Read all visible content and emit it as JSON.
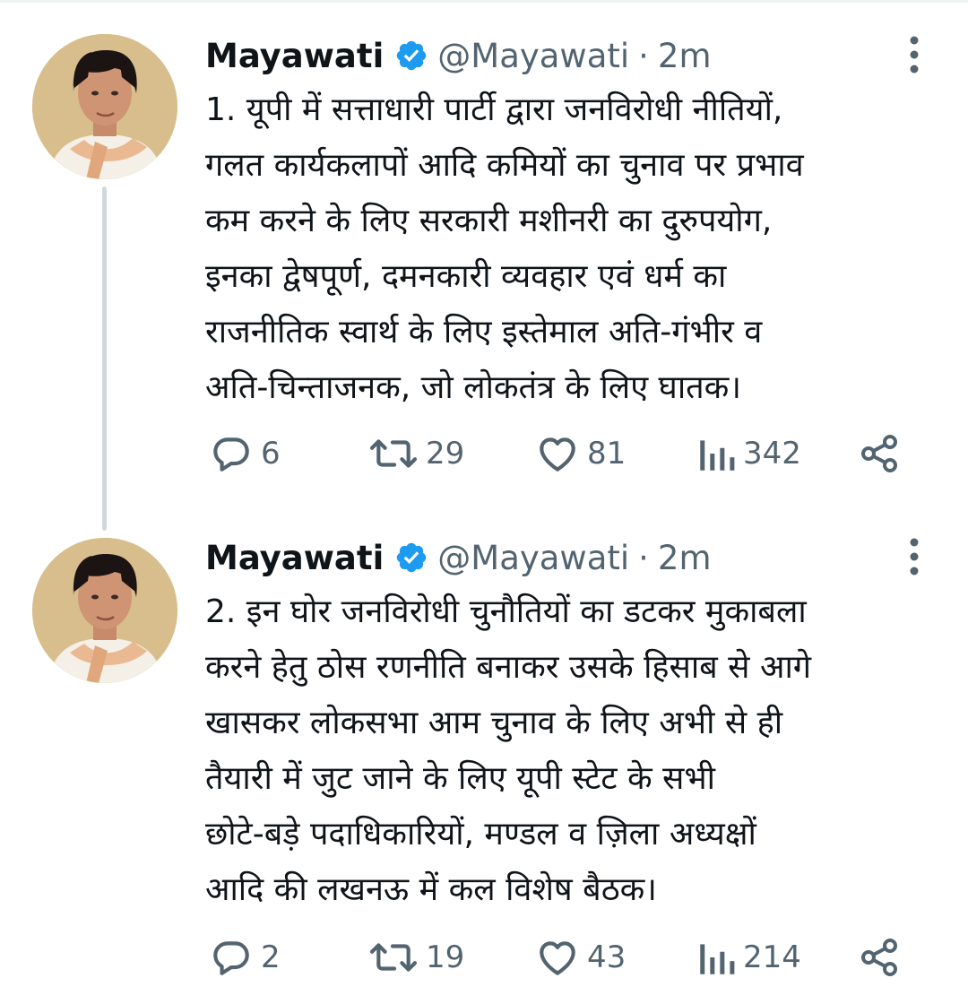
{
  "thread": {
    "tweets": [
      {
        "author": {
          "name": "Mayawati",
          "handle": "@Mayawati",
          "separator": "·",
          "time": "2m"
        },
        "text_lines": [
          "1. यूपी में सत्ताधारी पार्टी द्वारा जनविरोधी नीतियों,",
          "गलत कार्यकलापों आदि कमियों का चुनाव पर प्रभाव",
          "कम करने के लिए सरकारी मशीनरी का दुरुपयोग,",
          "इनका द्वेषपूर्ण, दमनकारी व्यवहार एवं धर्म का",
          "राजनीतिक स्वार्थ के लिए इस्तेमाल अति-गंभीर व",
          "अति-चिन्ताजनक, जो लोकतंत्र के लिए घातक।"
        ],
        "stats": {
          "replies": "6",
          "retweets": "29",
          "likes": "81",
          "views": "342"
        }
      },
      {
        "author": {
          "name": "Mayawati",
          "handle": "@Mayawati",
          "separator": "·",
          "time": "2m"
        },
        "text_lines": [
          "2. इन घोर जनविरोधी चुनौतियों का डटकर मुकाबला",
          "करने हेतु ठोस रणनीति बनाकर उसके हिसाब से आगे",
          "खासकर लोकसभा आम चुनाव के लिए अभी से ही",
          "तैयारी में जुट जाने के लिए यूपी स्टेट के सभी",
          "छोटे-बड़े पदाधिकारियों, मण्डल व ज़िला अध्यक्षों",
          "आदि की लखनऊ में कल विशेष बैठक।"
        ],
        "stats": {
          "replies": "2",
          "retweets": "19",
          "likes": "43",
          "views": "214"
        }
      }
    ]
  },
  "colors": {
    "text_primary": "#0f1419",
    "text_secondary": "#536471",
    "verified_blue": "#1d9bf0",
    "thread_line": "#cfd9de"
  },
  "icons": {
    "verified": "verified-badge-icon",
    "more": "more-vertical-icon",
    "reply": "reply-bubble-icon",
    "retweet": "retweet-arrows-icon",
    "like": "heart-icon",
    "views": "views-bars-icon",
    "share": "share-nodes-icon"
  }
}
